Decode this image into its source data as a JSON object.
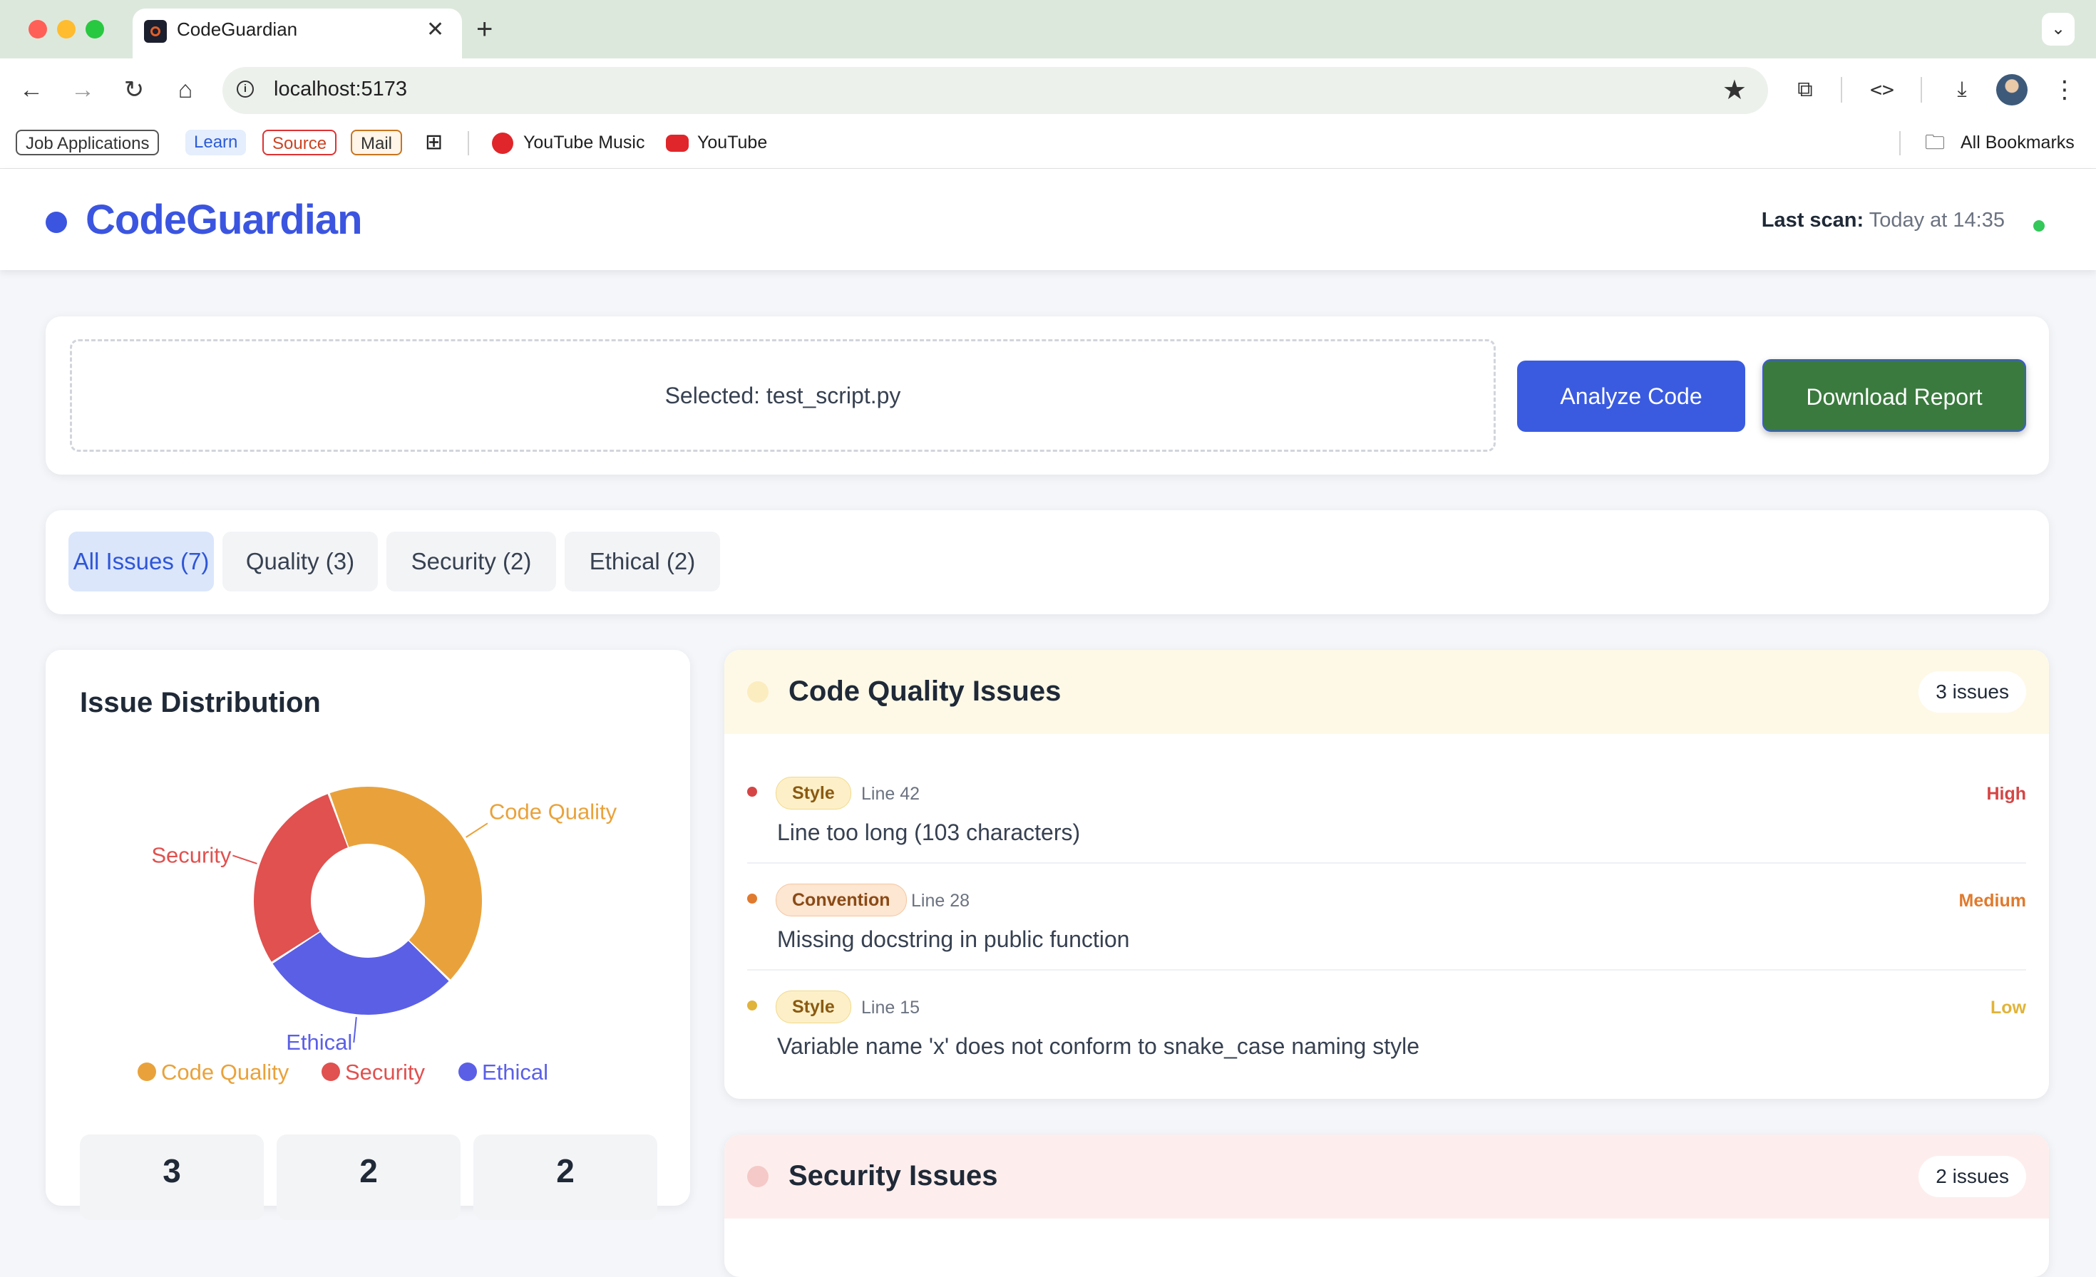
{
  "browser": {
    "tab_title": "CodeGuardian",
    "url": "localhost:5173",
    "bookmarks": {
      "job_applications": "Job Applications",
      "learn": "Learn",
      "source": "Source",
      "mail": "Mail",
      "youtube_music": "YouTube Music",
      "youtube": "YouTube",
      "all_bookmarks": "All Bookmarks"
    }
  },
  "header": {
    "brand": "CodeGuardian",
    "last_scan_label": "Last scan:",
    "last_scan_value": "Today at 14:35",
    "status_color": "#34c759"
  },
  "upload": {
    "selected_text": "Selected: test_script.py",
    "analyze_label": "Analyze Code",
    "download_label": "Download Report"
  },
  "filters": [
    {
      "label": "All Issues (7)",
      "active": true
    },
    {
      "label": "Quality (3)",
      "active": false
    },
    {
      "label": "Security (2)",
      "active": false
    },
    {
      "label": "Ethical (2)",
      "active": false
    }
  ],
  "distribution": {
    "title": "Issue Distribution",
    "stats": [
      "3",
      "2",
      "2"
    ]
  },
  "chart_data": {
    "type": "pie",
    "donut": true,
    "categories": [
      "Code Quality",
      "Security",
      "Ethical"
    ],
    "values": [
      3,
      2,
      2
    ],
    "colors": [
      "#e9a23b",
      "#e0514f",
      "#5b5fe6"
    ],
    "legend": "bottom"
  },
  "quality": {
    "title": "Code Quality Issues",
    "count_label": "3 issues",
    "issues": [
      {
        "tag": "Style",
        "line": "Line 42",
        "message": "Line too long (103 characters)",
        "severity": "High"
      },
      {
        "tag": "Convention",
        "line": "Line 28",
        "message": "Missing docstring in public function",
        "severity": "Medium"
      },
      {
        "tag": "Style",
        "line": "Line 15",
        "message": "Variable name 'x' does not conform to snake_case naming style",
        "severity": "Low"
      }
    ]
  },
  "security": {
    "title": "Security Issues",
    "count_label": "2 issues"
  },
  "colors": {
    "accent": "#3b55e0",
    "download": "#3a7a3e",
    "high": "#d64545",
    "medium": "#e07a2e",
    "low": "#e0b43a"
  }
}
